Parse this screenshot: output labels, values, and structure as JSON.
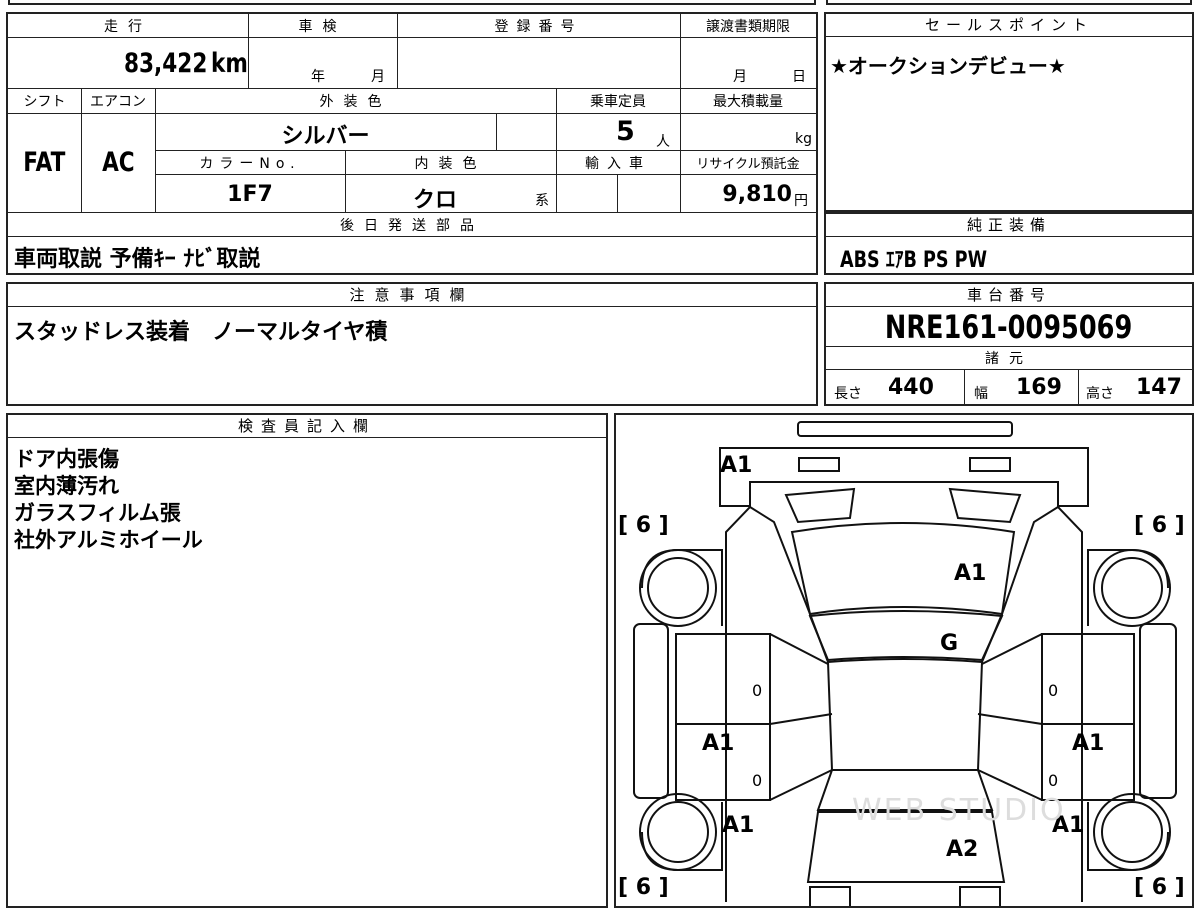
{
  "basic": {
    "mileage_label": "走行",
    "mileage": "83,422",
    "mileage_unit": "km",
    "shaken_label": "車検",
    "year_unit": "年",
    "month_unit": "月",
    "reg_label": "登録番号",
    "transfer_label": "譲渡書類期限",
    "month_unit2": "月",
    "day_unit": "日",
    "shift_label": "シフト",
    "shift": "FAT",
    "ac_label": "エアコン",
    "ac": "AC",
    "ext_color_label": "外装色",
    "ext_color": "シルバー",
    "capacity_label": "乗車定員",
    "capacity": "5",
    "capacity_unit": "人",
    "max_load_label": "最大積載量",
    "max_load_unit": "kg",
    "color_no_label": "カラーNo.",
    "color_no": "1F7",
    "int_color_label": "内装色",
    "int_color": "クロ",
    "int_color_suffix": "系",
    "import_label": "輸入車",
    "recycle_label": "リサイクル預託金",
    "recycle": "9,810",
    "recycle_unit": "円"
  },
  "sales": {
    "label": "セールスポイント",
    "text": "★オークションデビュー★"
  },
  "later": {
    "label": "後日発送部品",
    "text": "車両取説  予備ｷｰ  ﾅﾋﾞ取説"
  },
  "equip": {
    "label": "純正装備",
    "text": "ABS  ｴｱB  PS  PW"
  },
  "notes": {
    "label": "注意事項欄",
    "text": "スタッドレス装着　ノーマルタイヤ積"
  },
  "chassis": {
    "label": "車台番号",
    "number": "NRE161-0095069"
  },
  "specs": {
    "label": "諸元",
    "length_label": "長さ",
    "length": "440",
    "width_label": "幅",
    "width": "169",
    "height_label": "高さ",
    "height": "147"
  },
  "inspector": {
    "label": "検査員記入欄",
    "lines": [
      "ドア内張傷",
      "室内薄汚れ",
      "ガラスフィルム張",
      "社外アルミホイール"
    ]
  },
  "diagram": {
    "marks": {
      "front_bumper": "A1",
      "hood": "A1",
      "roof": "G",
      "left_door": "A1",
      "right_door": "A1",
      "left_rear_fender": "A1",
      "right_rear_fender": "A1",
      "trunk": "A2",
      "left_front_door_zero": "0",
      "left_rear_door_zero": "0",
      "right_front_door_zero": "0",
      "right_rear_door_zero": "0"
    },
    "tires": {
      "front_left": "[ 6 ]",
      "front_right": "[ 6 ]",
      "rear_left": "[ 6 ]",
      "rear_right": "[ 6 ]"
    },
    "watermark": "WEB STUDIO"
  }
}
